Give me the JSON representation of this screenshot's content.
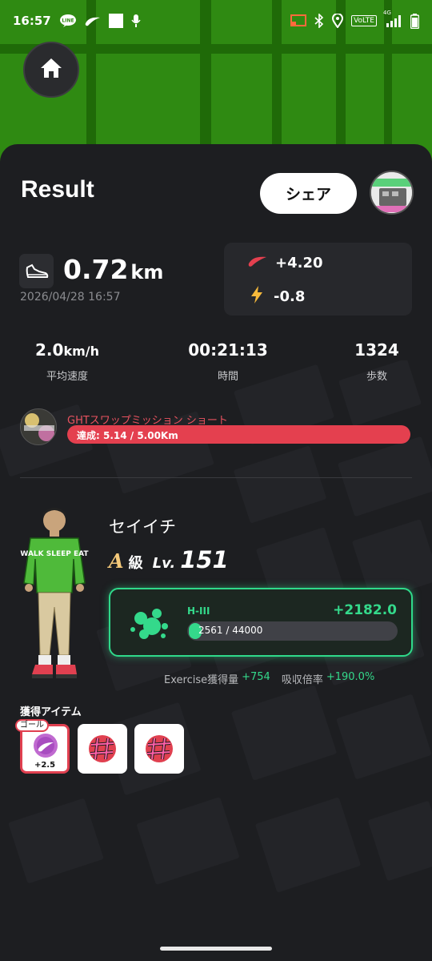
{
  "status_bar": {
    "time": "16:57",
    "left_icons": [
      "line-icon",
      "nike-icon",
      "square-icon",
      "mic-icon"
    ],
    "right_icons": [
      "cast-icon",
      "bluetooth-icon",
      "location-icon",
      "volte-icon",
      "signal-icon",
      "battery-icon"
    ],
    "volte_label": "VoLTE",
    "network_label": "4G"
  },
  "result": {
    "title": "Result",
    "share_label": "シェア"
  },
  "distance": {
    "value": "0.72",
    "unit": "km",
    "datetime": "2026/04/28 16:57"
  },
  "gains": {
    "nike": "+4.20",
    "energy": "-0.8"
  },
  "stats": [
    {
      "value": "2.0",
      "unit": "km/h",
      "label": "平均速度"
    },
    {
      "value": "00:21:13",
      "unit": "",
      "label": "時間"
    },
    {
      "value": "1324",
      "unit": "",
      "label": "歩数"
    }
  ],
  "mission": {
    "title": "GHTスワップミッション ショート",
    "progress_text": "達成: 5.14 / 5.00Km",
    "progress": 1.0
  },
  "character": {
    "name": "セイイチ",
    "rank": "A",
    "rank_suffix": "級",
    "level_label": "Lv.",
    "level": "151",
    "shirt_text": "WALK SLEEP EAT"
  },
  "energy_card": {
    "label": "H-III",
    "gain": "+2182.0",
    "progress_text": "2561 / 44000",
    "progress": 0.058
  },
  "exercise": {
    "label": "Exercise獲得量",
    "value": "+754",
    "absorb_label": "吸収倍率",
    "absorb_value": "+190.0%"
  },
  "items": {
    "title": "獲得アイテム",
    "goal_badge": "ゴール",
    "list": [
      {
        "icon": "nike-coin-icon",
        "count": "+2.5"
      },
      {
        "icon": "hashtag-sticker-icon",
        "count": ""
      },
      {
        "icon": "hashtag-sticker-icon",
        "count": ""
      }
    ]
  },
  "colors": {
    "accent_green": "#34d98b",
    "mission_red": "#e4404f",
    "rank_gold": "#f4c97a",
    "map_green": "#2f8a12"
  }
}
